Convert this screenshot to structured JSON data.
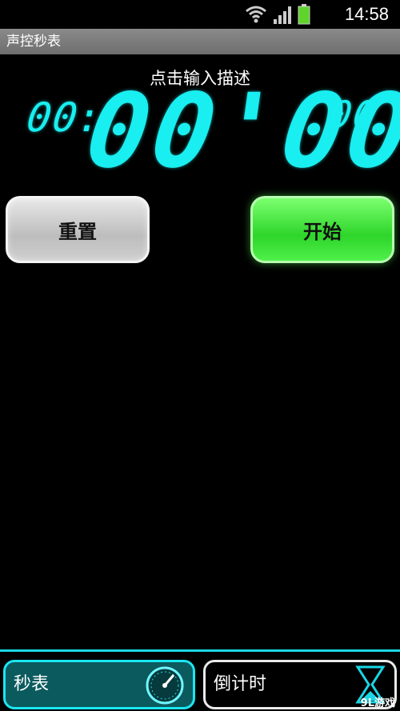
{
  "status_bar": {
    "time": "14:58",
    "icons": [
      "wifi-icon",
      "signal-icon",
      "battery-icon"
    ],
    "battery_color": "#5fd42a"
  },
  "app": {
    "title": "声控秒表"
  },
  "stopwatch": {
    "description": "点击输入描述",
    "hours": "00",
    "colon": ":",
    "main": "00'00",
    "hund_mark": "\"",
    "hundredths": "00",
    "digit_color": "#19eef0"
  },
  "buttons": {
    "reset_label": "重置",
    "start_label": "开始"
  },
  "tabs": [
    {
      "label": "秒表",
      "icon": "stopwatch-dial-icon",
      "active": true
    },
    {
      "label": "倒计时",
      "icon": "hourglass-icon",
      "active": false
    }
  ],
  "watermark": "9L游戏",
  "colors": {
    "accent": "#19d7e6",
    "start_button": "#3be036",
    "reset_button": "#cfcfcf"
  }
}
